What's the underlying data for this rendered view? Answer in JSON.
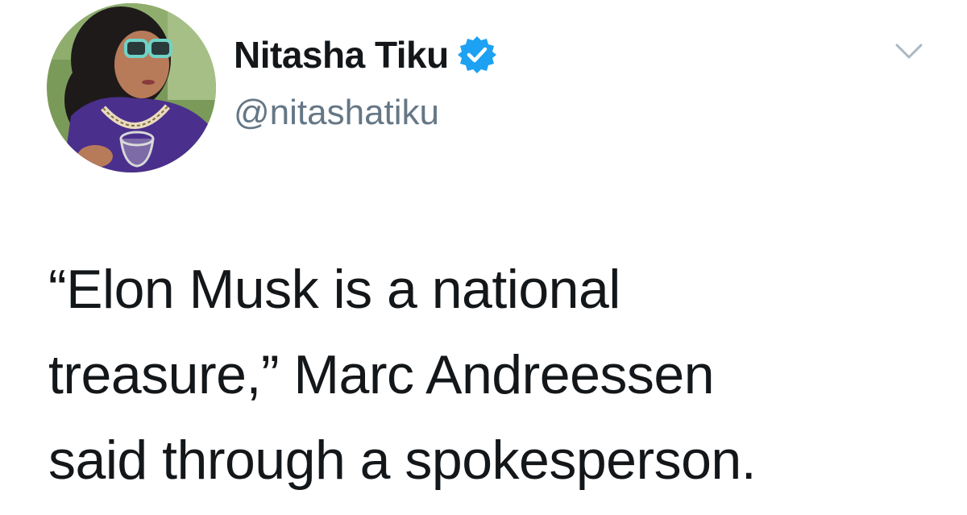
{
  "author": {
    "display_name": "Nitasha Tiku",
    "handle": "@nitashatiku",
    "verified": true,
    "avatar_icon": "profile-photo"
  },
  "tweet": {
    "text_lines": [
      "“Elon Musk is a national",
      "treasure,” Marc Andreessen",
      "said through a spokesperson."
    ]
  },
  "icons": {
    "verified": "verified-badge-icon",
    "menu": "chevron-down-icon"
  },
  "colors": {
    "text": "#14171a",
    "handle": "#657786",
    "verified_blue": "#1da1f2",
    "caret": "#aab8c2"
  }
}
